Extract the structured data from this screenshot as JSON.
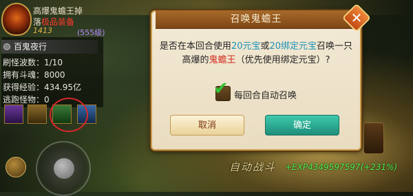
{
  "boss_banner": {
    "line1": "高爆鬼蟾王掉",
    "line2_prefix": "落",
    "line2_red": "极品装备",
    "level": "(555级)",
    "score": "1413"
  },
  "left_panel": {
    "title": "百鬼夜行",
    "stats": [
      "刷怪波数：1/10",
      "拥有斗魂：8000",
      "获得经验：434.95亿",
      "逃跑怪物：0"
    ]
  },
  "dialog": {
    "title": "召唤鬼蟾王",
    "message": {
      "part1": "是否在本回合使用",
      "blue1": "20元宝",
      "part2": "或",
      "blue2": "20绑定元宝",
      "part3": "召唤一只",
      "part4": "高爆的",
      "red1": "鬼蟾王",
      "part5": "（优先使用绑定元宝）?"
    },
    "checkbox_label": "每回合自动召唤",
    "checkbox_checked": true,
    "cancel_label": "取消",
    "confirm_label": "确定"
  },
  "hud": {
    "auto_fight": "自动战斗",
    "exp": "+EXP4349597597(+231%)"
  },
  "colors": {
    "dialog_bg": "#f3ead6",
    "title_bar": "#a86a2a",
    "confirm_button": "#2aa88f",
    "highlight_blue": "#1a92b8",
    "highlight_red": "#d2281a",
    "exp_green": "#4cf24c"
  }
}
